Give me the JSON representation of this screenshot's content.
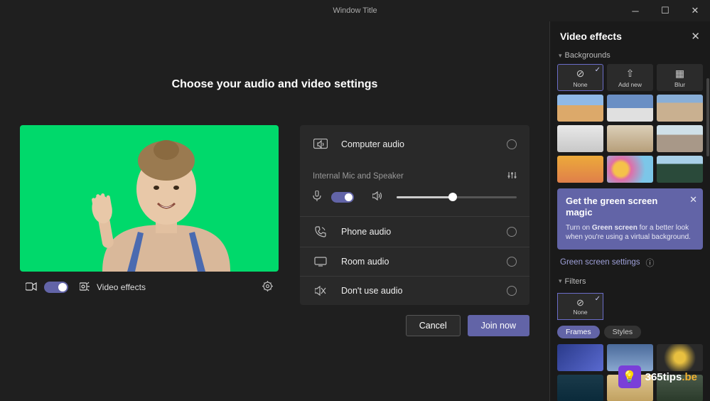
{
  "window": {
    "title": "Window Title"
  },
  "main": {
    "heading": "Choose your audio and video settings",
    "preview_bar": {
      "video_effects": "Video effects"
    },
    "audio": {
      "computer": "Computer audio",
      "device_sub": "Internal Mic and Speaker",
      "phone": "Phone audio",
      "room": "Room audio",
      "dont": "Don't use audio"
    },
    "actions": {
      "cancel": "Cancel",
      "join": "Join now"
    }
  },
  "panel": {
    "title": "Video effects",
    "section_bg": "Backgrounds",
    "tiles": {
      "none": "None",
      "add_new": "Add new",
      "blur": "Blur"
    },
    "tip": {
      "title": "Get the green screen magic",
      "body_pre": "Turn on ",
      "body_bold": "Green screen",
      "body_post": " for a better look when you're using a virtual background."
    },
    "link": "Green screen settings",
    "section_filters": "Filters",
    "pills": {
      "frames": "Frames",
      "styles": "Styles"
    }
  },
  "watermark": {
    "brand": "365tips",
    "suffix": ".be",
    "emoji": "💡"
  }
}
